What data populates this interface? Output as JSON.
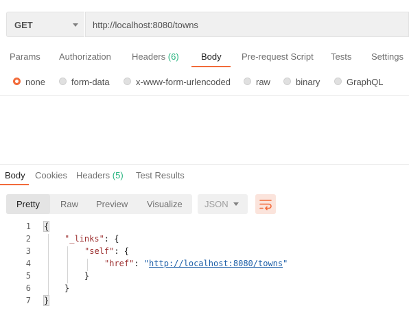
{
  "request": {
    "method": "GET",
    "url": "http://localhost:8080/towns"
  },
  "request_tabs": [
    {
      "label": "Params"
    },
    {
      "label": "Authorization"
    },
    {
      "label": "Headers",
      "count": "(6)"
    },
    {
      "label": "Body"
    },
    {
      "label": "Pre-request Script"
    },
    {
      "label": "Tests"
    },
    {
      "label": "Settings"
    }
  ],
  "active_request_tab": "Body",
  "body_types": [
    {
      "label": "none",
      "selected": true
    },
    {
      "label": "form-data"
    },
    {
      "label": "x-www-form-urlencoded"
    },
    {
      "label": "raw"
    },
    {
      "label": "binary"
    },
    {
      "label": "GraphQL"
    }
  ],
  "response_tabs": [
    {
      "label": "Body"
    },
    {
      "label": "Cookies"
    },
    {
      "label": "Headers",
      "count": "(5)"
    },
    {
      "label": "Test Results"
    }
  ],
  "active_response_tab": "Body",
  "view_modes": [
    "Pretty",
    "Raw",
    "Preview",
    "Visualize"
  ],
  "active_view_mode": "Pretty",
  "format": "JSON",
  "icons": {
    "method_dropdown": "chevron-down-icon",
    "format_dropdown": "chevron-down-icon",
    "wrap": "wrap-lines-icon"
  },
  "colors": {
    "accent": "#f26b3a",
    "count": "#26b47f",
    "key": "#9c2f2f",
    "link": "#1d5fa8"
  },
  "code": {
    "line_numbers": [
      "1",
      "2",
      "3",
      "4",
      "5",
      "6",
      "7"
    ],
    "open_brace": "{",
    "links_key": "\"_links\"",
    "self_key": "\"self\"",
    "href_key": "\"href\"",
    "href_value": "http://localhost:8080/towns",
    "close_brace": "}"
  }
}
